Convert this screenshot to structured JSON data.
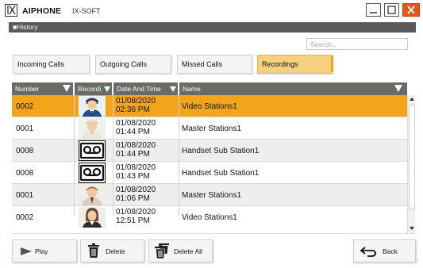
{
  "window": {
    "brand": "AIPHONE",
    "app": "IX-SOFT"
  },
  "section": {
    "title": "■History"
  },
  "search": {
    "placeholder": "Search..."
  },
  "filters": [
    {
      "label": "Incoming Calls",
      "active": false
    },
    {
      "label": "Outgoing Calls",
      "active": false
    },
    {
      "label": "Missed Calls",
      "active": false
    },
    {
      "label": "Recordings",
      "active": true
    }
  ],
  "table": {
    "columns": [
      "Number",
      "Recordi",
      "Date And Time",
      "Name"
    ],
    "rows": [
      {
        "number": "0002",
        "thumb": "video-station-person-icon",
        "date": "01/08/2020",
        "time": "02:36 PM",
        "name": "Video Stations1",
        "selected": true
      },
      {
        "number": "0001",
        "thumb": "master-station-person-icon",
        "date": "01/08/2020",
        "time": "01:44 PM",
        "name": "Master Stations1",
        "selected": false
      },
      {
        "number": "0008",
        "thumb": "voicemail-tape-icon",
        "date": "01/08/2020",
        "time": "01:44 PM",
        "name": "Handset Sub Station1",
        "selected": false
      },
      {
        "number": "0008",
        "thumb": "voicemail-tape-icon",
        "date": "01/08/2020",
        "time": "01:43 PM",
        "name": "Handset Sub Station1",
        "selected": false
      },
      {
        "number": "0001",
        "thumb": "master-station-person-icon",
        "date": "01/08/2020",
        "time": "01:06 PM",
        "name": "Master Stations1",
        "selected": false
      },
      {
        "number": "0002",
        "thumb": "video-station-person-icon",
        "date": "01/08/2020",
        "time": "12:51 PM",
        "name": "Video Stations1",
        "selected": false
      }
    ]
  },
  "actions": {
    "play": "Play",
    "delete": "Delete",
    "delete_all": "Delete All",
    "back": "Back"
  },
  "colors": {
    "accent": "#f2a51a",
    "header": "#6a6a6a",
    "close": "#e9541c"
  }
}
